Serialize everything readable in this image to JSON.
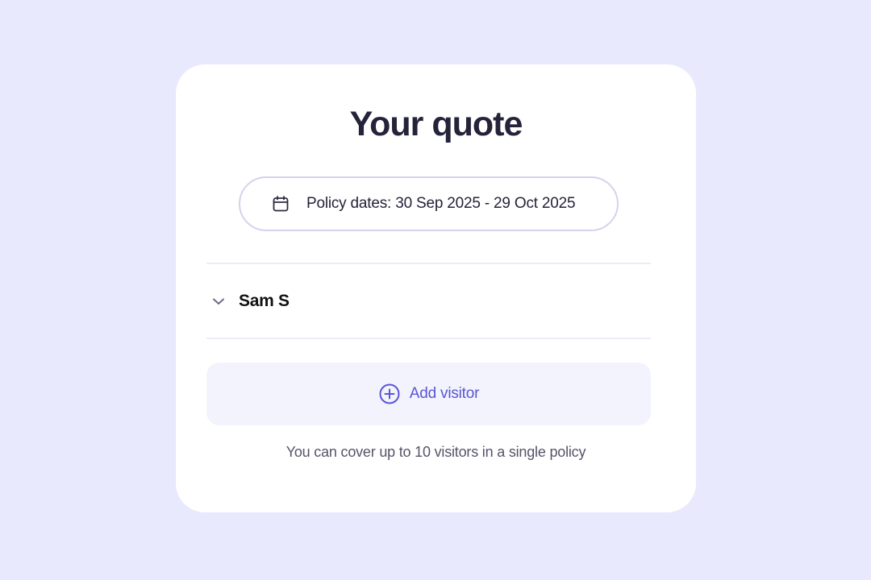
{
  "quote": {
    "title": "Your quote",
    "policy_dates": {
      "label": "Policy dates: 30 Sep 2025 - 29 Oct 2025",
      "icon": "calendar-icon"
    },
    "visitors": [
      {
        "name": "Sam S",
        "icon": "chevron-down-icon"
      }
    ],
    "add_visitor": {
      "label": "Add visitor",
      "icon": "plus-circle-icon"
    },
    "helper_text": "You can cover up to 10 visitors in a single policy"
  },
  "colors": {
    "page_background": "#e8e9fd",
    "card_background": "#ffffff",
    "title_text": "#24233a",
    "accent": "#5a55d6",
    "add_visitor_background": "#f3f3fd",
    "pill_border": "#d3d3ee"
  }
}
